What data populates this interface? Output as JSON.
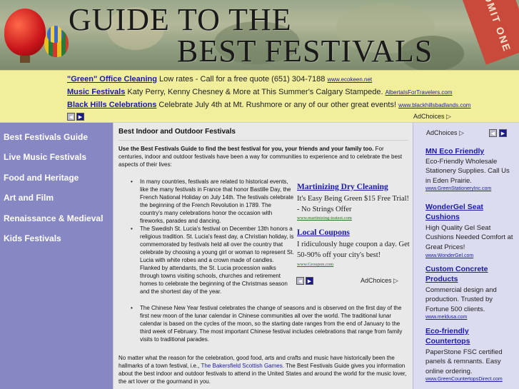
{
  "header": {
    "title_line1": "GUIDE TO THE",
    "title_line2": "BEST FESTIVALS",
    "ticket_text": "ADMIT ONE"
  },
  "top_ads": {
    "rows": [
      {
        "title": "\"Green\" Office Cleaning",
        "text": "Low rates - Call for a free quote (651) 304-7188",
        "url": "www.ecokeen.net"
      },
      {
        "title": "Music Festivals",
        "text": "Katy Perry, Kenny Chesney & More at This Summer's Calgary Stampede.",
        "url": "AlbertaIsForTravelers.com"
      },
      {
        "title": "Black Hills Celebrations",
        "text": "Celebrate July 4th at Mt. Rushmore or any of our other great events!",
        "url": "www.blackhillsbadlands.com"
      }
    ],
    "adchoices_label": "AdChoices"
  },
  "nav": {
    "items": [
      "Best Festivals Guide",
      "Live Music Festivals",
      "Food and Heritage",
      "Art and Film",
      "Renaissance & Medieval",
      "Kids Festivals"
    ]
  },
  "main": {
    "title": "Best Indoor and Outdoor Festivals",
    "intro_bold": "Use the Best Festivals Guide to find the best festival for you, your friends and your family too.",
    "intro_text": "For centuries, indoor and outdoor festivals have been a way for communities to experience and to celebrate the best aspects of their lives:",
    "bullets": [
      "In many countries, festivals are related to historical events, like the many festivals in France that honor Bastille Day, the French National Holiday on July 14th. The festivals celebrate the beginning of the French Revolution in 1789. The country's many celebrations honor the occasion with fireworks, parades and dancing.",
      "The Swedish St. Lucia's festival on December 13th honors a religious tradition. St. Lucia's feast day, a Christian holiday, is commemorated by festivals held all over the country that celebrate by choosing a young girl or woman to represent St. Lucia with white robes and a crown made of candles. Flanked by attendants, the St. Lucia procession walks through towns visiting schools, churches and retirement homes to celebrate the beginning of the Christmas season and the shortest day of the year.",
      "The Chinese New Year festival celebrates the change of seasons and is observed on the first day of the first new moon of the lunar calendar in Chinese communities all over the world. The traditional lunar calendar is based on the cycles of the moon, so the starting date ranges from the end of January to the third week of February. The most important Chinese festival includes celebrations that range from family visits to traditional parades."
    ],
    "outro_before": "No matter what the reason for the celebration, good food, arts and crafts and music have historically been the hallmarks of a town festival, i.e.,",
    "outro_link": "The Bakersfield Scottish Games.",
    "outro_after": "The Best Festivals Guide gives you information about the best indoor and outdoor festivals to attend in the United States and around the world for the music lover, the art lover or the gourmand in you."
  },
  "inline_ads": {
    "ads": [
      {
        "title": "Martinizing Dry Cleaning",
        "text": "It's Easy Being Green $15 Free Trial! - No Strings Offer",
        "url": "www.martinizing-teatest.com"
      },
      {
        "title": "Local Coupons",
        "text": "I ridiculously huge coupon a day. Get 50-90% off your city's best!",
        "url": "www.Groupon.com"
      }
    ],
    "adchoices_label": "AdChoices"
  },
  "right_ads": {
    "adchoices_label": "AdChoices",
    "ads": [
      {
        "title": "MN Eco Friendly",
        "text": "Eco-Friendly Wholesale Stationery Supplies. Call Us in Eden Prairie.",
        "url": "www.GreenStationeryInc.com"
      },
      {
        "title": "WonderGel Seat Cushions",
        "text": "High Quality Gel Seat Cushions Needed Comfort at Great Prices!",
        "url": "www.WonderGel.com"
      },
      {
        "title": "Custom Concrete Products",
        "text": "Commercial design and production. Trusted by Fortune 500 clients.",
        "url": "www.meldusa.com"
      },
      {
        "title": "Eco-friendly Countertops",
        "text": "PaperStone FSC certified panels & remnants. Easy online ordering.",
        "url": "www.GreenCountertopsDirect.com"
      }
    ]
  }
}
